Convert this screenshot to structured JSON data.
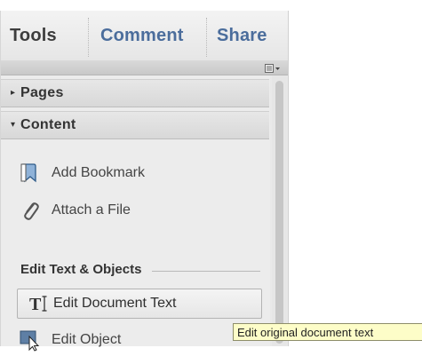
{
  "tabs": [
    {
      "label": "Tools"
    },
    {
      "label": "Comment"
    },
    {
      "label": "Share"
    }
  ],
  "sections": {
    "pages": {
      "label": "Pages",
      "expanded": false
    },
    "content": {
      "label": "Content",
      "expanded": true
    }
  },
  "content_items": [
    {
      "label": "Add Bookmark",
      "icon": "bookmark-icon"
    },
    {
      "label": "Attach a File",
      "icon": "paperclip-icon"
    }
  ],
  "edit_group": {
    "heading": "Edit Text & Objects",
    "items": [
      {
        "label": "Edit Document Text",
        "icon": "edit-text-icon",
        "selected": true
      },
      {
        "label": "Edit Object",
        "icon": "edit-object-icon",
        "selected": false
      }
    ]
  },
  "tooltip": {
    "text": "Edit original document text"
  },
  "colors": {
    "tab_active": "#3d3d3d",
    "tab_link": "#4b6d9c",
    "tooltip_bg": "#fdfdc8",
    "panel_bg": "#ececec"
  }
}
